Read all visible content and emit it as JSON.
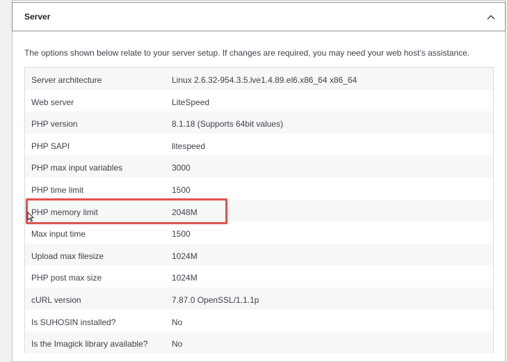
{
  "section": {
    "title": "Server",
    "intro": "The options shown below relate to your server setup. If changes are required, you may need your web host’s assistance."
  },
  "rows": [
    {
      "label": "Server architecture",
      "value": "Linux 2.6.32-954.3.5.lve1.4.89.el6.x86_64 x86_64"
    },
    {
      "label": "Web server",
      "value": "LiteSpeed"
    },
    {
      "label": "PHP version",
      "value": "8.1.18 (Supports 64bit values)"
    },
    {
      "label": "PHP SAPI",
      "value": "litespeed"
    },
    {
      "label": "PHP max input variables",
      "value": "3000"
    },
    {
      "label": "PHP time limit",
      "value": "1500"
    },
    {
      "label": "PHP memory limit",
      "value": "2048M"
    },
    {
      "label": "Max input time",
      "value": "1500"
    },
    {
      "label": "Upload max filesize",
      "value": "1024M"
    },
    {
      "label": "PHP post max size",
      "value": "1024M"
    },
    {
      "label": "cURL version",
      "value": "7.87.0 OpenSSL/1.1.1p"
    },
    {
      "label": "Is SUHOSIN installed?",
      "value": "No"
    },
    {
      "label": "Is the Imagick library available?",
      "value": "No"
    }
  ],
  "icons": {
    "collapse": "chevron-up-icon",
    "cursor": "mouse-pointer-icon"
  },
  "colors": {
    "highlight": "#e05252",
    "stripe": "#f6f7f7"
  }
}
